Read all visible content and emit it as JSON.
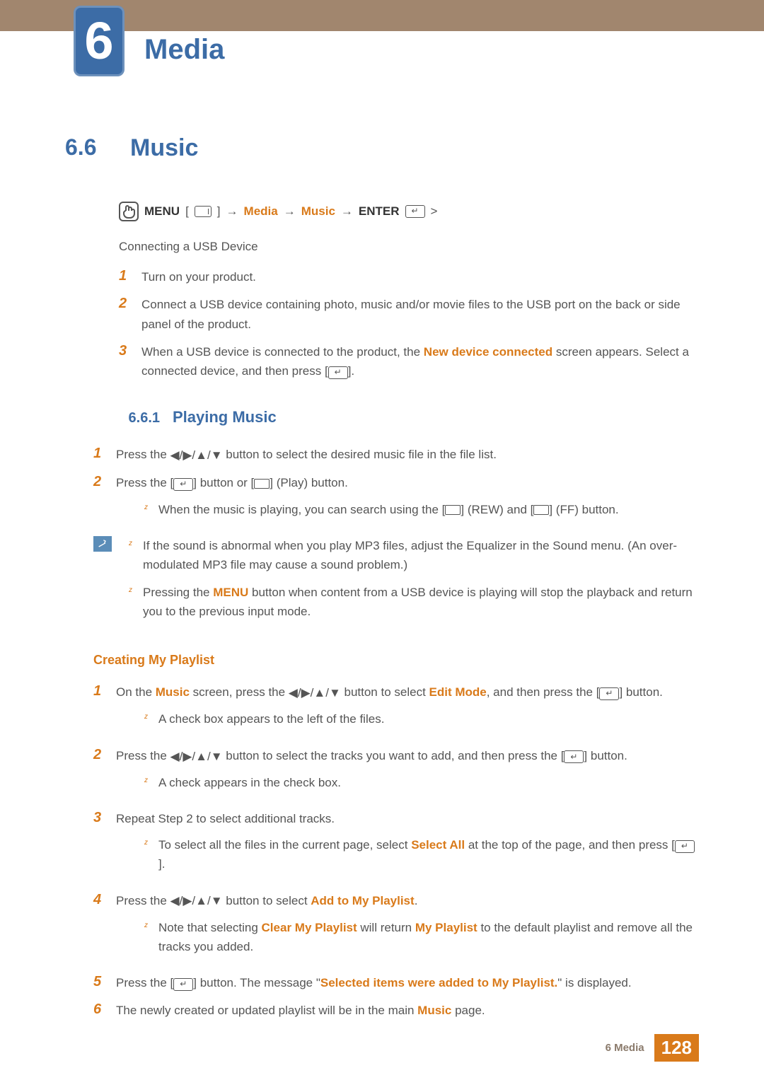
{
  "chapter": {
    "number": "6",
    "title": "Media"
  },
  "section": {
    "number": "6.6",
    "title": "Music"
  },
  "breadcrumb": {
    "menu": "MENU",
    "media": "Media",
    "music": "Music",
    "enter": "ENTER",
    "arrow": "→",
    "gt": ">"
  },
  "intro": "Connecting a USB Device",
  "usb_steps": [
    {
      "n": "1",
      "text": "Turn on your product."
    },
    {
      "n": "2",
      "text": "Connect a USB device containing photo, music and/or movie files to the USB port on the back or side panel of the product."
    },
    {
      "n": "3",
      "pre": "When a USB device is connected to the product, the ",
      "hl": "New device connected",
      "mid": " screen appears. Select a connected device, and then press [",
      "post": "]."
    }
  ],
  "subsection": {
    "number": "6.6.1",
    "title": "Playing Music"
  },
  "play_steps": [
    {
      "n": "1",
      "pre": "Press the ",
      "post": " button to select the desired music file in the file list."
    },
    {
      "n": "2",
      "pre": "Press the [",
      "mid": "] button or [",
      "post": "] (Play) button."
    }
  ],
  "play_sub1": {
    "pre": "When the music is playing, you can search using the [",
    "mid": "] (REW) and [",
    "post": "] (FF) button."
  },
  "notes": [
    {
      "pre": "If the sound is abnormal when you play MP3 files, adjust the Equalizer in the Sound menu. (An over-modulated MP3 file may cause a sound problem.)"
    },
    {
      "pre": "Pressing the ",
      "hl": "MENU",
      "post": " button when content from a USB device is playing will stop the playback and return you to the previous input mode."
    }
  ],
  "playlist_heading": "Creating My Playlist",
  "playlist_steps": [
    {
      "n": "1",
      "pre": "On the ",
      "hl1": "Music",
      "mid1": " screen, press the ",
      "mid2": " button to select ",
      "hl2": "Edit Mode",
      "mid3": ", and then press the [",
      "post": "] button."
    },
    {
      "n": "2",
      "pre": "Press the ",
      "mid": " button to select the tracks you want to add, and then press the [",
      "post": "] button."
    },
    {
      "n": "3",
      "text": "Repeat Step 2 to select additional tracks."
    },
    {
      "n": "4",
      "pre": "Press the ",
      "mid": " button to select ",
      "hl": "Add to My Playlist",
      "post": "."
    },
    {
      "n": "5",
      "pre": "Press the [",
      "mid": "] button. The message \"",
      "hl": "Selected items were added to My Playlist.",
      "post": "\" is displayed."
    },
    {
      "n": "6",
      "pre": "The newly created or updated playlist will be in the main ",
      "hl": "Music",
      "post": " page."
    }
  ],
  "playlist_sub1": "A check box appears to the left of the files.",
  "playlist_sub2": "A check appears in the check box.",
  "playlist_sub3": {
    "pre": "To select all the files in the current page, select ",
    "hl": "Select All",
    "mid": " at the top of the page, and then press [",
    "post": "]."
  },
  "playlist_sub4": {
    "pre": "Note that selecting ",
    "hl1": "Clear My Playlist",
    "mid": " will return ",
    "hl2": "My Playlist",
    "post": " to the default playlist and remove all the tracks you added."
  },
  "footer": {
    "label": "6 Media",
    "page": "128"
  }
}
